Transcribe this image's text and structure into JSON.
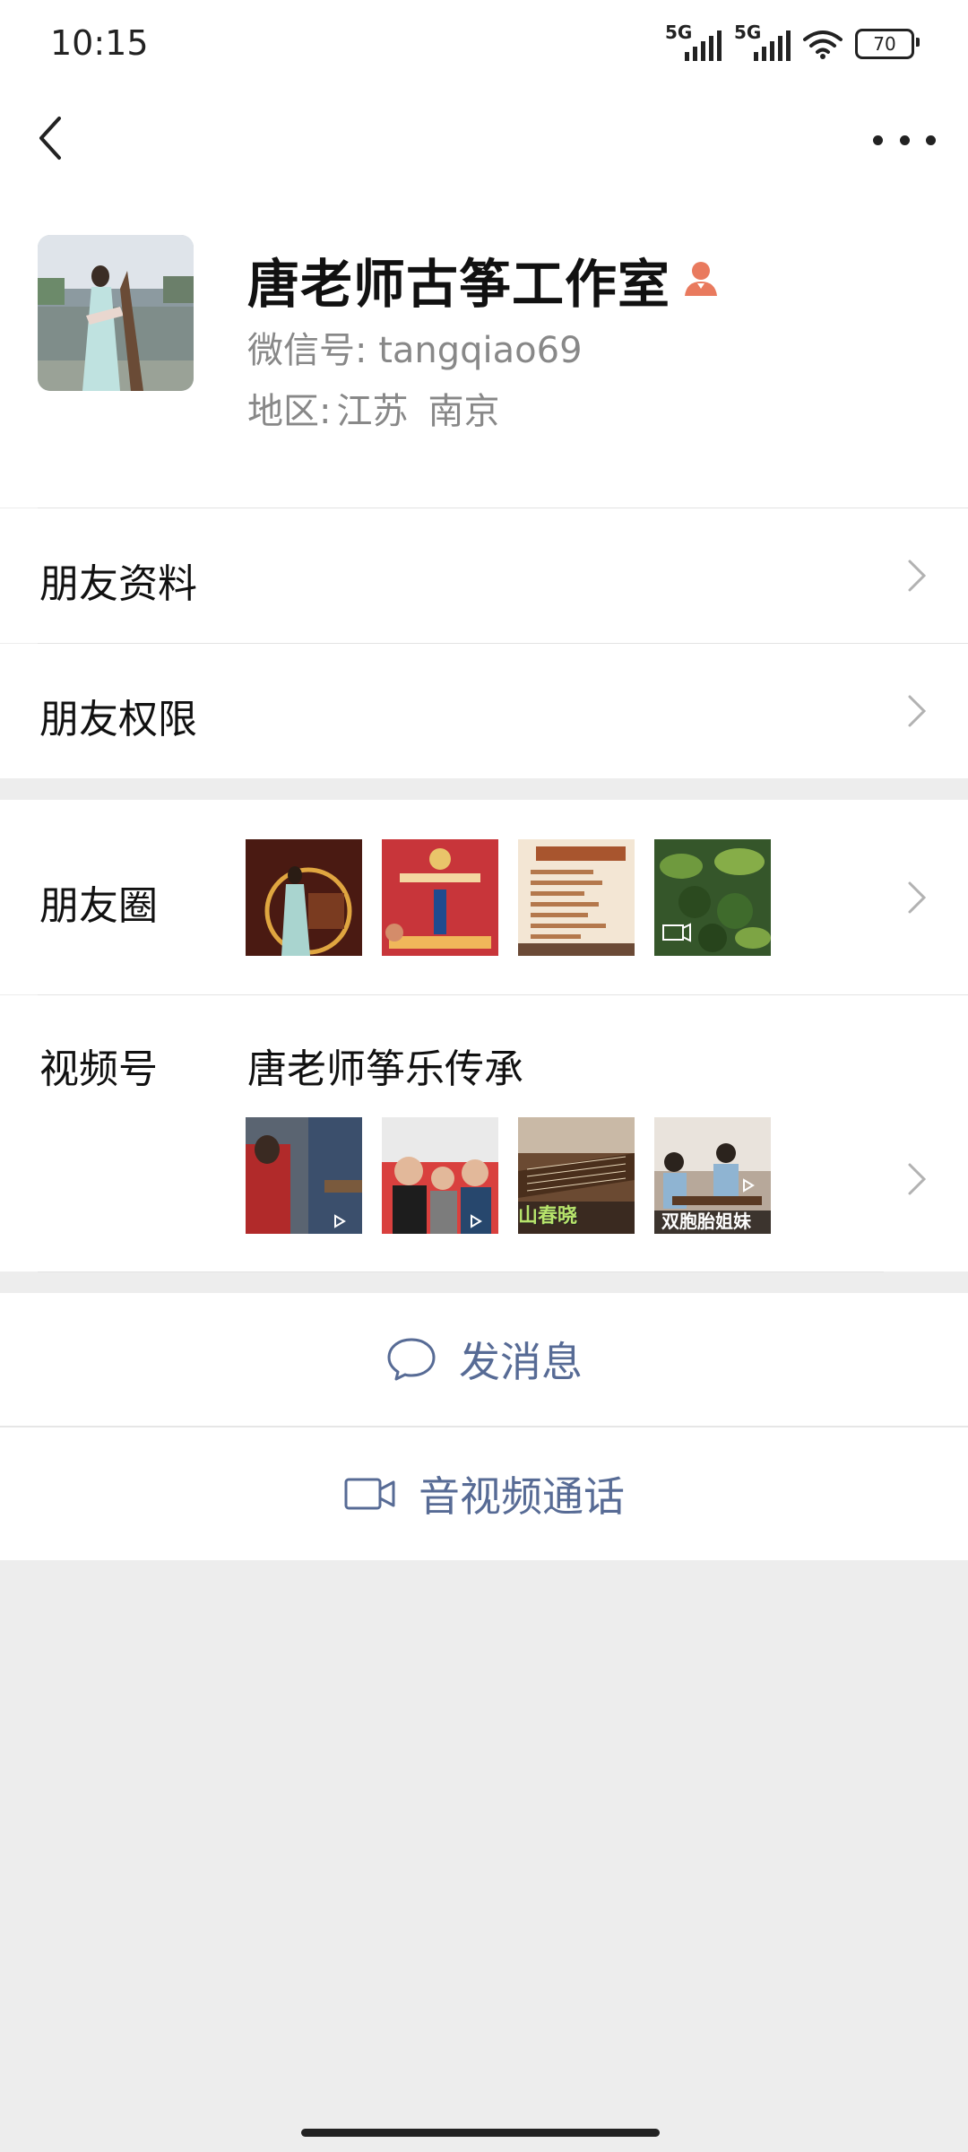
{
  "status_bar": {
    "time": "10:15",
    "network1": "5G",
    "network2": "5G",
    "battery": "70"
  },
  "nav": {
    "back_icon": "chevron-left-icon",
    "more_icon": "more-dots-icon"
  },
  "profile": {
    "name": "唐老师古筝工作室",
    "wechat_id_label": "微信号:",
    "wechat_id": "tangqiao69",
    "region_label": "地区:",
    "region_province": "江苏",
    "region_city": "南京",
    "badge_icon": "person-icon"
  },
  "menu": {
    "friend_profile": "朋友资料",
    "friend_permissions": "朋友权限"
  },
  "moments": {
    "label": "朋友圈"
  },
  "channels": {
    "label": "视频号",
    "channel_name": "唐老师筝乐传承",
    "thumb_captions": [
      "",
      "",
      "山春晓",
      "双胞胎姐妹"
    ]
  },
  "actions": {
    "message": "发消息",
    "call": "音视频通话"
  },
  "colors": {
    "link": "#576b95",
    "badge": "#e97a5e",
    "background": "#ededed"
  }
}
